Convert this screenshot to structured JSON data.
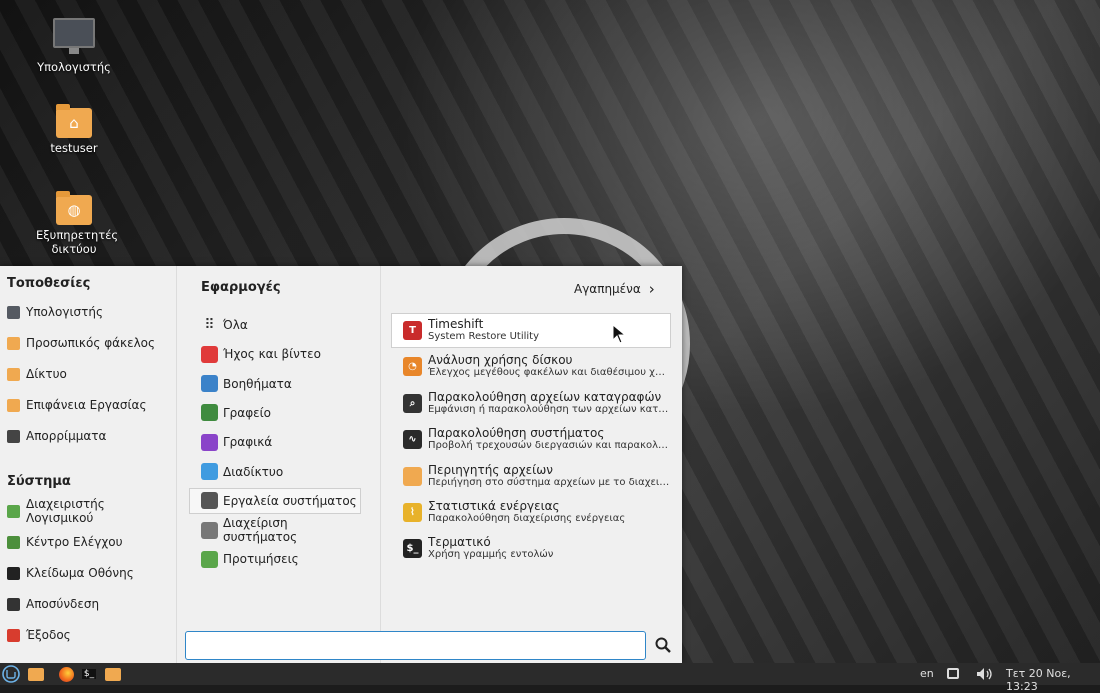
{
  "desktop": {
    "icons": [
      {
        "label": "Υπολογιστής",
        "icon": "computer-icon"
      },
      {
        "label": "testuser",
        "icon": "home-folder-icon"
      },
      {
        "label": "Εξυπηρετητές δικτύου",
        "icon": "network-folder-icon"
      }
    ]
  },
  "menu": {
    "places_title": "Τοποθεσίες",
    "places": [
      {
        "label": "Υπολογιστής",
        "icon": "computer-icon",
        "color": "#555a62"
      },
      {
        "label": "Προσωπικός φάκελος",
        "icon": "home-folder-icon",
        "color": "#f0a950"
      },
      {
        "label": "Δίκτυο",
        "icon": "network-folder-icon",
        "color": "#f0a950"
      },
      {
        "label": "Επιφάνεια Εργασίας",
        "icon": "desktop-folder-icon",
        "color": "#f0a950"
      },
      {
        "label": "Απορρίμματα",
        "icon": "trash-icon",
        "color": "#444444"
      }
    ],
    "system_title": "Σύστημα",
    "system": [
      {
        "label": "Διαχειριστής Λογισμικού",
        "icon": "software-manager-icon",
        "color": "#5aa64a"
      },
      {
        "label": "Κέντρο Ελέγχου",
        "icon": "control-center-icon",
        "color": "#4c8f3c"
      },
      {
        "label": "Κλείδωμα Οθόνης",
        "icon": "lock-icon",
        "color": "#222222"
      },
      {
        "label": "Αποσύνδεση",
        "icon": "logout-icon",
        "color": "#333333"
      },
      {
        "label": "Έξοδος",
        "icon": "power-icon",
        "color": "#d83c2e"
      }
    ],
    "apps_title": "Εφαρμογές",
    "favorites_label": "Αγαπημένα",
    "categories": [
      {
        "label": "Όλα",
        "icon": "grid-icon",
        "color": "#333333"
      },
      {
        "label": "Ήχος και βίντεο",
        "icon": "media-icon",
        "color": "#e03a3a"
      },
      {
        "label": "Βοηθήματα",
        "icon": "accessories-icon",
        "color": "#3b82c9"
      },
      {
        "label": "Γραφείο",
        "icon": "office-icon",
        "color": "#3f8b3f"
      },
      {
        "label": "Γραφικά",
        "icon": "graphics-icon",
        "color": "#8a44c9"
      },
      {
        "label": "Διαδίκτυο",
        "icon": "internet-icon",
        "color": "#3f9be0"
      },
      {
        "label": "Εργαλεία συστήματος",
        "icon": "system-tools-icon",
        "color": "#555555"
      },
      {
        "label": "Διαχείριση συστήματος",
        "icon": "administration-icon",
        "color": "#777777"
      },
      {
        "label": "Προτιμήσεις",
        "icon": "preferences-icon",
        "color": "#5aa64a"
      }
    ],
    "active_category": "Εργαλεία συστήματος",
    "apps": [
      {
        "name": "Timeshift",
        "desc": "System Restore Utility",
        "icon": "timeshift-icon",
        "color": "#c92b2b",
        "glyph": "T"
      },
      {
        "name": "Ανάλυση χρήσης δίσκου",
        "desc": "Έλεγχος μεγέθους φακέλων και διαθέσιμου χώρου ...",
        "icon": "disk-usage-icon",
        "color": "#e8862a",
        "glyph": "◔"
      },
      {
        "name": "Παρακολούθηση αρχείων καταγραφών",
        "desc": "Εμφάνιση ή παρακολούθηση των αρχείων καταγρα...",
        "icon": "log-viewer-icon",
        "color": "#333333",
        "glyph": "⌕"
      },
      {
        "name": "Παρακολούθηση συστήματος",
        "desc": "Προβολή τρεχουσών διεργασιών και παρακολούθη...",
        "icon": "system-monitor-icon",
        "color": "#2a2a2a",
        "glyph": "∿"
      },
      {
        "name": "Περιηγητής αρχείων",
        "desc": "Περιήγηση στο σύστημα αρχείων με το διαχειριστή ...",
        "icon": "file-manager-icon",
        "color": "#f0a950",
        "glyph": ""
      },
      {
        "name": "Στατιστικά ενέργειας",
        "desc": "Παρακολούθηση διαχείρισης ενέργειας",
        "icon": "power-statistics-icon",
        "color": "#e8b22a",
        "glyph": "⌇"
      },
      {
        "name": "Τερματικό",
        "desc": "Χρήση γραμμής εντολών",
        "icon": "terminal-icon",
        "color": "#222222",
        "glyph": "$_"
      }
    ],
    "search": {
      "value": "",
      "placeholder": ""
    }
  },
  "taskbar": {
    "keyboard_layout": "en",
    "clock": "Τετ 20 Νοε, 13:23"
  }
}
